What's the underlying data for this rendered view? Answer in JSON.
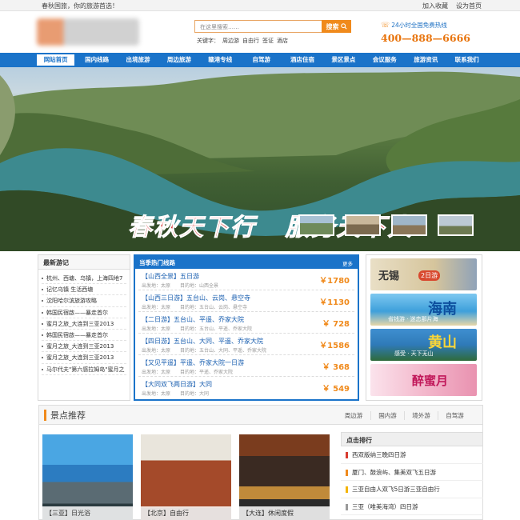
{
  "topbar": {
    "welcome": "春秋国旅，你的旅游首选！",
    "bookmark": "加入收藏",
    "homepage": "设为首页"
  },
  "header": {
    "search_placeholder": "在这里搜索……",
    "search_button": "搜索",
    "keywords_label": "关键字：",
    "keywords": [
      "周边游",
      "自由行",
      "签证",
      "酒店"
    ],
    "hotline_label": "24小时全国免费热线",
    "hotline_number": "400—888—6666"
  },
  "nav": [
    "网站首页",
    "国内线路",
    "出境旅游",
    "周边旅游",
    "赣港专线",
    "自驾游",
    "酒店住宿",
    "景区景点",
    "会议服务",
    "旅游资讯",
    "联系我们"
  ],
  "banner": {
    "slogan_left": "春秋天下行",
    "slogan_right": "服务天下人"
  },
  "journals": {
    "title": "最新游记",
    "items": [
      "杭州、西塘、乌镇，上海四地7",
      "记忆乌镇 生活西塘",
      "沈阳哈尔滨旅游攻略",
      "韩国民宿啟——暴走首尔",
      "蜜月之旅_大连到三亚2013",
      "韩国民宿啟——暴走首尔",
      "蜜月之旅_大连到三亚2013",
      "蜜月之旅_大连到三亚2013",
      "马尔代夫\"第六感拉姆岛\"蜜月之"
    ]
  },
  "hot_routes": {
    "title": "当季热门线路",
    "more": "更多",
    "routes": [
      {
        "name": "【山西全景】五日游",
        "meta": "出发地：太原　　目的地：山西全景",
        "price": "￥1780"
      },
      {
        "name": "【山西三日游】五台山、云岗、悬空寺",
        "meta": "出发地：太原　　目的地：五台山、云岗、悬空寺",
        "price": "￥1130"
      },
      {
        "name": "【二日游】五台山、平遥、乔家大院",
        "meta": "出发地：太原　　目的地：五台山、平遥、乔家大院",
        "price": "￥ 728"
      },
      {
        "name": "【四日游】五台山、大同、平遥、乔家大院",
        "meta": "出发地：太原　　目的地：五台山、大同、平遥、乔家大院",
        "price": "￥1586"
      },
      {
        "name": "【又见平遥】平遥、乔家大院一日游",
        "meta": "出发地：太原　　目的地：平遥、乔家大院",
        "price": "￥ 368"
      },
      {
        "name": "【大同双飞两日游】大同",
        "meta": "出发地：太原　　目的地：大同",
        "price": "￥ 549"
      }
    ]
  },
  "ads": [
    {
      "t1": "无锡",
      "t2": "2日游"
    },
    {
      "t1": "海南",
      "t2": "省钱游 · 迷恋那片海"
    },
    {
      "t1": "黄山",
      "t2": "感受 · 天下无山"
    },
    {
      "t1": "醉蜜月",
      "t2": ""
    }
  ],
  "scenic": {
    "title": "景点推荐",
    "tabs": [
      "周边游",
      "国内游",
      "境外游",
      "自驾游"
    ],
    "photos": [
      "【三亚】日光浴",
      "【北京】自由行",
      "【大连】休闲度假"
    ]
  },
  "rank": {
    "title": "点击排行",
    "items": [
      "西双版纳三晚四日游",
      "厦门、鼓浪屿、集美双飞五日游",
      "三亚自由人双飞5日游三亚自由行",
      "三亚（唯美海湾）四日游"
    ]
  },
  "colors": {
    "brand_blue": "#1a73c9",
    "accent_orange": "#f08a1c",
    "price_orange": "#f08a1c"
  }
}
